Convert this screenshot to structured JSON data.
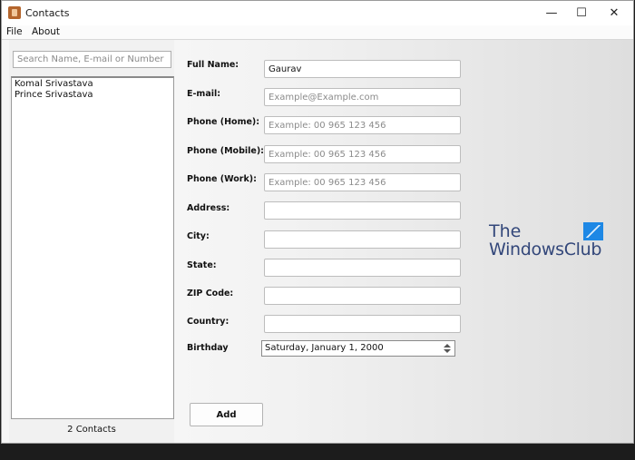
{
  "window": {
    "title": "Contacts",
    "controls": {
      "minimize": "—",
      "maximize": "☐",
      "close": "✕"
    }
  },
  "menu": [
    "File",
    "About"
  ],
  "search": {
    "placeholder": "Search Name, E-mail or Number",
    "value": ""
  },
  "contacts": [
    "Komal Srivastava",
    "Prince Srivastava"
  ],
  "contact_count": "2 Contacts",
  "form": {
    "full_name": {
      "label": "Full Name:",
      "value": "Gaurav",
      "placeholder": ""
    },
    "email": {
      "label": "E-mail:",
      "value": "",
      "placeholder": "Example@Example.com"
    },
    "phone_home": {
      "label": "Phone (Home):",
      "value": "",
      "placeholder": "Example: 00 965 123 456"
    },
    "phone_mobile": {
      "label": "Phone (Mobile):",
      "value": "",
      "placeholder": "Example: 00 965 123 456"
    },
    "phone_work": {
      "label": "Phone (Work):",
      "value": "",
      "placeholder": "Example: 00 965 123 456"
    },
    "address": {
      "label": "Address:",
      "value": ""
    },
    "city": {
      "label": "City:",
      "value": ""
    },
    "state": {
      "label": "State:",
      "value": ""
    },
    "zip": {
      "label": "ZIP Code:",
      "value": ""
    },
    "country": {
      "label": "Country:",
      "value": ""
    },
    "birthday": {
      "label": "Birthday",
      "value": "Saturday, January 1, 2000"
    }
  },
  "add_button": "Add",
  "watermark": {
    "line1": "The",
    "line2": "WindowsClub"
  },
  "colors": {
    "accent": "#1e88e5",
    "watermark_text": "#33477a"
  }
}
